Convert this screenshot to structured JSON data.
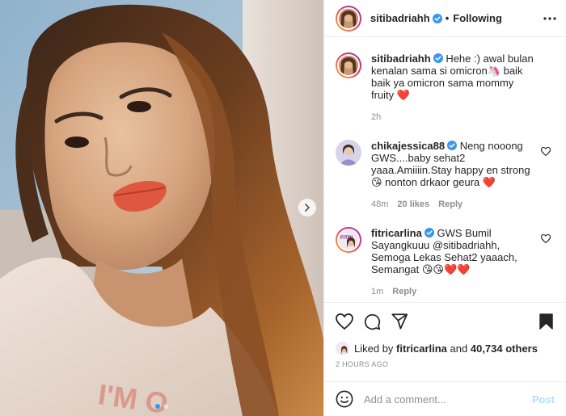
{
  "post": {
    "username": "sitibadriahh",
    "follow_status": "Following",
    "separator": "•",
    "more_icon": "more-horizontal-icon"
  },
  "caption": {
    "username": "sitibadriahh",
    "text": "Hehe :) awal bulan kenalan sama si omicron🦄 baik baik ya omicron sama mommy fruity ❤️",
    "time": "2h"
  },
  "comments": [
    {
      "username": "chikajessica88",
      "text": "Neng nooong GWS....baby sehat2 yaaa.Amiiiin.Stay happy en strong 😘 nonton drkaor geura ❤️",
      "time": "48m",
      "likes": "20 likes",
      "reply": "Reply"
    },
    {
      "username": "fitricarlina",
      "text": "GWS Bumil Sayangkuuu @sitibadriahh, Semoga Lekas Sehat2 yaaach, Semangat 😘😘❤️❤️",
      "time": "1m",
      "reply": "Reply"
    }
  ],
  "likes_line": {
    "prefix": "Liked by",
    "liker": "fitricarlina",
    "middle": "and",
    "others": "40,734 others"
  },
  "timestamp": "2 HOURS AGO",
  "composer": {
    "placeholder": "Add a comment...",
    "post_label": "Post"
  },
  "photo_text": "I'M O",
  "carousel": {
    "slides": 2,
    "active": 1
  },
  "colors": {
    "verified": "#3897f0",
    "link_disabled": "#b2dffc",
    "heart": "#ed4956",
    "secondary_text": "#8e8e8e"
  }
}
